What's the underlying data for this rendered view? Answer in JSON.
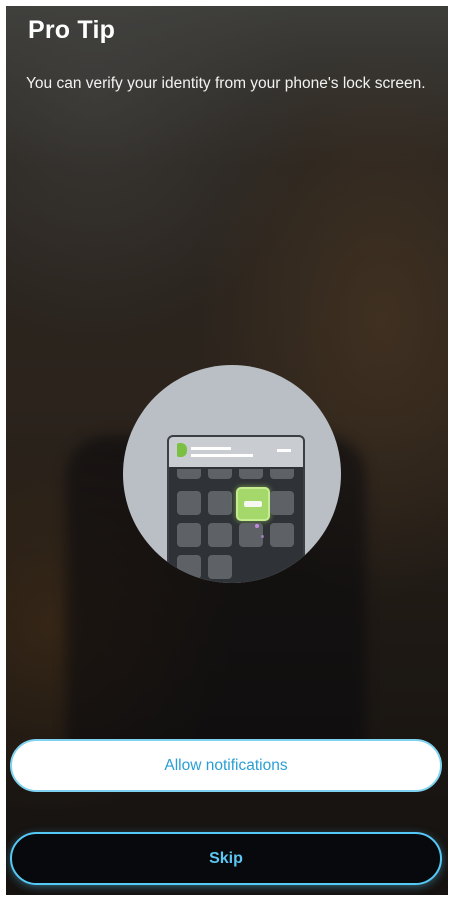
{
  "screen": {
    "title": "Pro Tip",
    "message": "You can verify your identity from your phone's lock screen."
  },
  "illustration": {
    "icon": "lock-screen-notification-illustration",
    "accent_color": "#a5d86a"
  },
  "actions": {
    "allow_label": "Allow notifications",
    "skip_label": "Skip"
  },
  "colors": {
    "primary_accent": "#2a9fd6",
    "button_outline": "#56c8f5"
  }
}
